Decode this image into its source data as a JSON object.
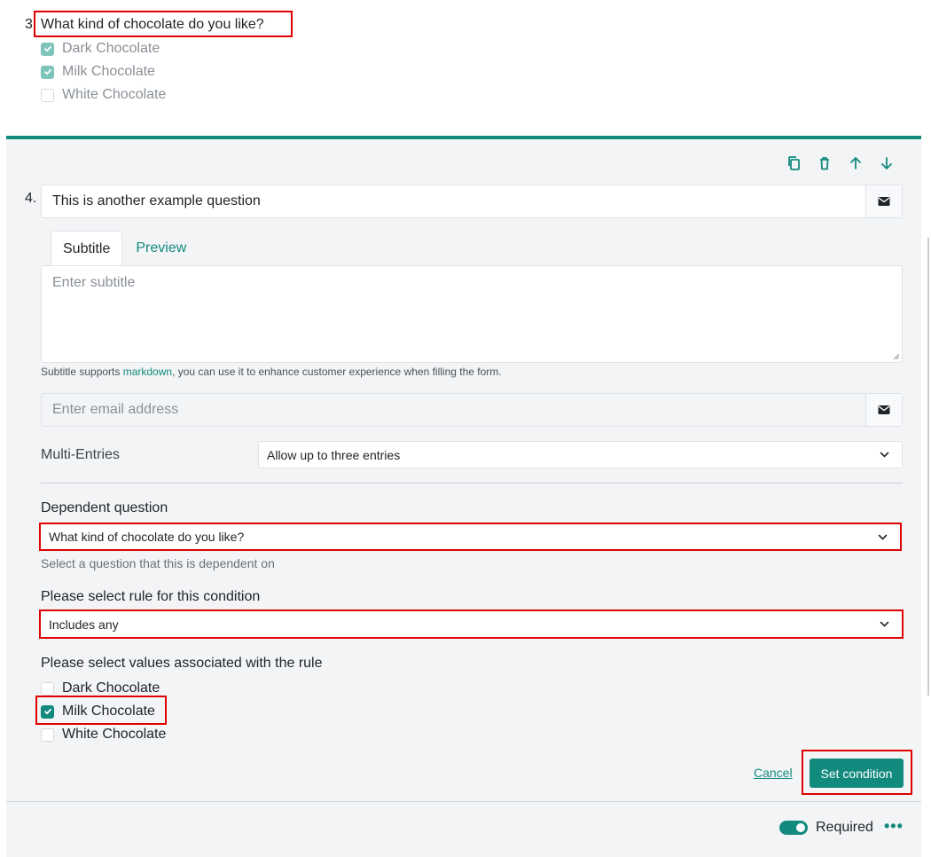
{
  "question3": {
    "number": "3",
    "title": "What kind of chocolate do you like?",
    "options": [
      {
        "label": "Dark Chocolate",
        "checked": true
      },
      {
        "label": "Milk Chocolate",
        "checked": true
      },
      {
        "label": "White Chocolate",
        "checked": false
      }
    ]
  },
  "question4": {
    "number": "4.",
    "title": "This is another example question",
    "title_icon": "envelope-icon",
    "toolbar": [
      "copy-icon",
      "trash-icon",
      "arrow-up-icon",
      "arrow-down-icon"
    ],
    "tabs": [
      {
        "label": "Subtitle",
        "active": true
      },
      {
        "label": "Preview",
        "active": false
      }
    ],
    "subtitle_placeholder": "Enter subtitle",
    "subtitle_hint_prefix": "Subtitle supports ",
    "subtitle_hint_link": "markdown",
    "subtitle_hint_suffix": ", you can use it to enhance customer experience when filling the form.",
    "email_placeholder": "Enter email address",
    "multi_entries_label": "Multi-Entries",
    "multi_entries_value": "Allow up to three entries",
    "dependent_label": "Dependent question",
    "dependent_value": "What kind of chocolate do you like?",
    "dependent_hint": "Select a question that this is dependent on",
    "rule_label": "Please select rule for this condition",
    "rule_value": "Includes any",
    "values_label": "Please select values associated with the rule",
    "values": [
      {
        "label": "Dark Chocolate",
        "checked": false
      },
      {
        "label": "Milk Chocolate",
        "checked": true
      },
      {
        "label": "White Chocolate",
        "checked": false
      }
    ],
    "cancel_label": "Cancel",
    "set_condition_label": "Set condition",
    "required_label": "Required",
    "required_on": true,
    "more_label": "•••"
  },
  "colors": {
    "accent": "#138a7e",
    "highlight": "#e00000",
    "card_bg": "#f3f4f6"
  }
}
